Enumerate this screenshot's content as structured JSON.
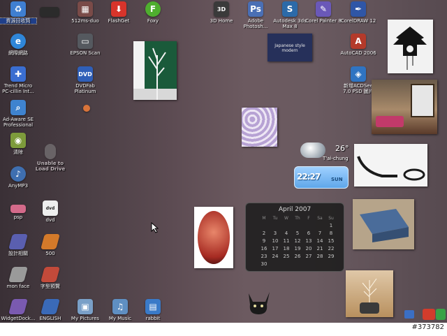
{
  "colors": {
    "desktop_dark": "#3a3036",
    "desktop_mid": "#6c5a60",
    "label_text": "#f2f2f2",
    "calendar_bg": "#1c1c1c",
    "clock_bg": "#5fa7ea"
  },
  "desktop_icons": [
    {
      "name": "recycle-bin",
      "label": "資源回收筒",
      "icon": "recycle-bin-icon",
      "color": "#3f7fd1",
      "selected": true
    },
    {
      "name": "unnamed-dark",
      "label": "",
      "icon": "dark-panel-icon",
      "color": "#2b2b2b"
    },
    {
      "name": "512ms-duo",
      "label": "512ms-duo",
      "icon": "chip-icon",
      "color": "#7a4b48"
    },
    {
      "name": "flashget",
      "label": "FlashGet",
      "icon": "flashget-icon",
      "color": "#d8342b"
    },
    {
      "name": "foxy",
      "label": "Foxy",
      "icon": "foxy-icon",
      "color": "#4fae2f"
    },
    {
      "name": "3d-home",
      "label": "3D Home",
      "icon": "3d-home-icon",
      "color": "#3a3a3a"
    },
    {
      "name": "adobe-photoshop",
      "label": "Adobe Photosh...",
      "icon": "photoshop-icon",
      "color": "#4a6fb5"
    },
    {
      "name": "autodesk-3ds-max",
      "label": "Autodesk 3ds Max 8",
      "icon": "3ds-max-icon",
      "color": "#2c6aa8"
    },
    {
      "name": "corel-painter",
      "label": "Corel Painter 8",
      "icon": "painter-icon",
      "color": "#6a58b8"
    },
    {
      "name": "coreldraw",
      "label": "CorelDRAW 12",
      "icon": "coreldraw-icon",
      "color": "#2f56a6"
    },
    {
      "name": "network",
      "label": "網際網路",
      "icon": "internet-explorer-icon",
      "color": "#2f86d8"
    },
    {
      "name": "epson-scan",
      "label": "EPSON Scan",
      "icon": "scanner-icon",
      "color": "#55595f"
    },
    {
      "name": "autocad",
      "label": "AutoCAD 2006",
      "icon": "autocad-icon",
      "color": "#b43a2a"
    },
    {
      "name": "trend-micro",
      "label": "Trend Micro PC-cillin Int...",
      "icon": "antivirus-icon",
      "color": "#3a6ed1"
    },
    {
      "name": "dvdfab",
      "label": "DVDFab Platinum",
      "icon": "dvd-icon",
      "color": "#2f5fb8"
    },
    {
      "name": "acdsee",
      "label": "新增ACDSee 7.0 PSD 圖片",
      "icon": "acdsee-icon",
      "color": "#2f74c2"
    },
    {
      "name": "small-orb",
      "label": "",
      "icon": "orb-icon",
      "color": "#d9743a"
    },
    {
      "name": "ad-aware",
      "label": "Ad-Aware SE Professional",
      "icon": "magnifier-icon",
      "color": "#3f83cf"
    },
    {
      "name": "qingjie",
      "label": "清除",
      "icon": "cleaner-icon",
      "color": "#7d9b3b"
    },
    {
      "name": "unable-to-load",
      "label": "Unable to Load Drive",
      "icon": "drive-icon",
      "color": "#8e8e8e",
      "faded": true
    },
    {
      "name": "anymp3",
      "label": "AnyMP3",
      "icon": "music-player-icon",
      "color": "#3f6fb0"
    },
    {
      "name": "psp",
      "label": "psp",
      "icon": "psp-icon",
      "color": "#d46a8a"
    },
    {
      "name": "dvd",
      "label": "dvd",
      "icon": "dvd-folder-icon",
      "color": "#eeeeee"
    },
    {
      "name": "sheji",
      "label": "設計相關",
      "icon": "book-icon",
      "color": "#5a5fb0"
    },
    {
      "name": "500",
      "label": "500",
      "icon": "book-orange-icon",
      "color": "#d47a2a"
    },
    {
      "name": "mon-face",
      "label": "mon face",
      "icon": "book-gray-icon",
      "color": "#9a9a9a"
    },
    {
      "name": "zixing",
      "label": "字型預覽",
      "icon": "book-red-icon",
      "color": "#c24a3a"
    },
    {
      "name": "widgetdock",
      "label": "WidgetDock...",
      "icon": "book-purple-icon",
      "color": "#7a5ab0"
    },
    {
      "name": "english",
      "label": "ENGLISH",
      "icon": "book-blue-icon",
      "color": "#3a6ab8"
    },
    {
      "name": "my-pictures",
      "label": "My Pictures",
      "icon": "pictures-folder-icon",
      "color": "#7aa0c8"
    },
    {
      "name": "my-music",
      "label": "My Music",
      "icon": "music-folder-icon",
      "color": "#5f8fc2"
    },
    {
      "name": "rabbit",
      "label": "rabbit",
      "icon": "rabbit-icon",
      "color": "#3a7ac8"
    }
  ],
  "weather": {
    "temp": "26°",
    "city": "T'ai-chung"
  },
  "clock": {
    "time": "22:27",
    "day": "SUN"
  },
  "calendar": {
    "month_title": "April 2007",
    "weekdays": [
      "M",
      "Tu",
      "W",
      "Th",
      "F",
      "Sa",
      "Su"
    ],
    "weeks": [
      [
        "",
        "",
        "",
        "",
        "",
        "",
        "1"
      ],
      [
        "2",
        "3",
        "4",
        "5",
        "6",
        "7",
        "8"
      ],
      [
        "9",
        "10",
        "11",
        "12",
        "13",
        "14",
        "15"
      ],
      [
        "16",
        "17",
        "18",
        "19",
        "20",
        "21",
        "22"
      ],
      [
        "23",
        "24",
        "25",
        "26",
        "27",
        "28",
        "29"
      ],
      [
        "30",
        "",
        "",
        "",
        "",
        "",
        ""
      ]
    ]
  },
  "photos": [
    {
      "name": "tree-photo",
      "bg": "#1a5a3a"
    },
    {
      "name": "japanese-style-photo",
      "caption": "Japanese style modern",
      "bg": "#26305a"
    },
    {
      "name": "cuckoo-clock-photo",
      "bg": "#f2f2f2"
    },
    {
      "name": "interior-room-photo",
      "bg": "#8a6a4a"
    },
    {
      "name": "purple-pattern-photo",
      "bg": "#b7a2d4"
    },
    {
      "name": "lounge-chair-photo",
      "bg": "#f4f4f4"
    },
    {
      "name": "red-frame-photo",
      "bg": "#c24a3a"
    },
    {
      "name": "metal-shelf-photo",
      "bg": "#b6a48a"
    },
    {
      "name": "tree-lamp-photo",
      "bg": "#c4a27a"
    }
  ],
  "footer": {
    "build_tag": "#373782"
  }
}
